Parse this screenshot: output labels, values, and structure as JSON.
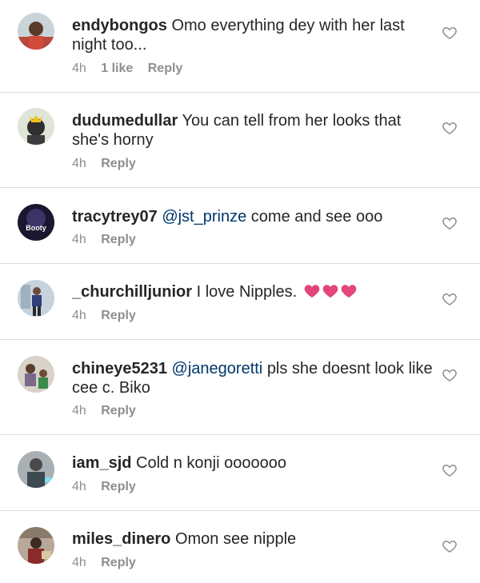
{
  "colors": {
    "mention": "#00376b",
    "meta": "#8e8e8e",
    "separator": "#dbdbdb",
    "emoji_heart": "#e2467a"
  },
  "icons": {
    "like": "heart-outline-icon",
    "emoji": "heart-emoji-icon"
  },
  "avatars": {
    "tracytrey07_text": "Booty"
  },
  "comments": [
    {
      "username": "endybongos",
      "text": "Omo everything dey with her last night too...",
      "time": "4h",
      "likes": "1 like",
      "reply": "Reply"
    },
    {
      "username": "dudumedullar",
      "text": "You can tell from her looks that she's horny",
      "time": "4h",
      "reply": "Reply"
    },
    {
      "username": "tracytrey07",
      "mention": "@jst_prinze",
      "text": "come and see ooo",
      "time": "4h",
      "reply": "Reply"
    },
    {
      "username": "_churchilljunior",
      "text": "I love Nipples.",
      "time": "4h",
      "reply": "Reply"
    },
    {
      "username": "chineye5231",
      "mention": "@janegoretti",
      "text": "pls she doesnt look like cee c. Biko",
      "time": "4h",
      "reply": "Reply"
    },
    {
      "username": "iam_sjd",
      "text": "Cold n konji ooooooo",
      "time": "4h",
      "reply": "Reply"
    },
    {
      "username": "miles_dinero",
      "text": "Omon see nipple",
      "time": "4h",
      "reply": "Reply"
    }
  ]
}
